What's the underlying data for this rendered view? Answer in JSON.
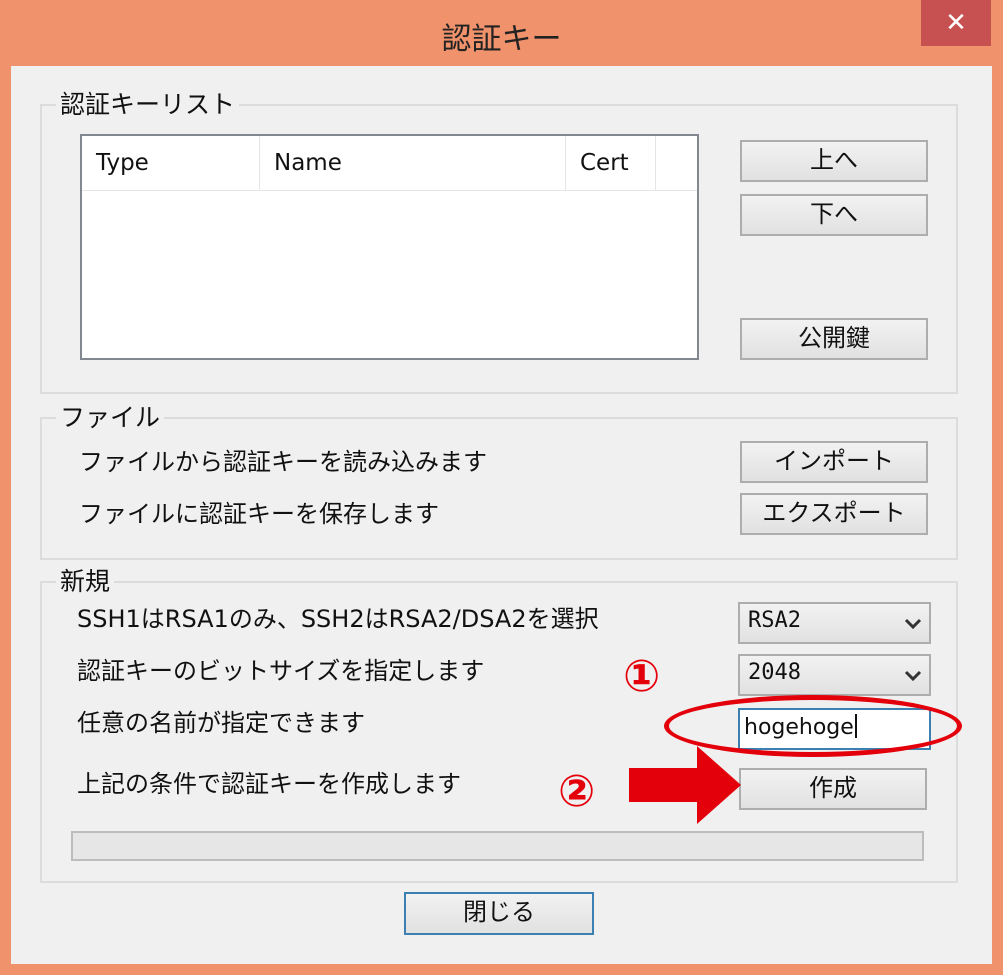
{
  "window": {
    "title": "認証キー",
    "close_glyph": "✕"
  },
  "key_list": {
    "group_label": "認証キーリスト",
    "columns": [
      "Type",
      "Name",
      "Cert"
    ],
    "rows": [],
    "up_button": "上へ",
    "down_button": "下へ",
    "public_key_button": "公開鍵"
  },
  "file": {
    "group_label": "ファイル",
    "import_text": "ファイルから認証キーを読み込みます",
    "import_button": "インポート",
    "export_text": "ファイルに認証キーを保存します",
    "export_button": "エクスポート"
  },
  "new_key": {
    "group_label": "新規",
    "type_text": "SSH1はRSA1のみ、SSH2はRSA2/DSA2を選択",
    "type_value": "RSA2",
    "bits_text": "認証キーのビットサイズを指定します",
    "bits_value": "2048",
    "name_text": "任意の名前が指定できます",
    "name_value": "hogehoge",
    "create_text": "上記の条件で認証キーを作成します",
    "create_button": "作成",
    "progress": 0
  },
  "close_button": "閉じる",
  "annotations": {
    "step1": "①",
    "step2": "②",
    "color": "#e3000b"
  },
  "colors": {
    "title_bar": "#f0926b",
    "close_button": "#c75050",
    "client": "#f0f0f0",
    "focus_border": "#3c7fb1"
  }
}
